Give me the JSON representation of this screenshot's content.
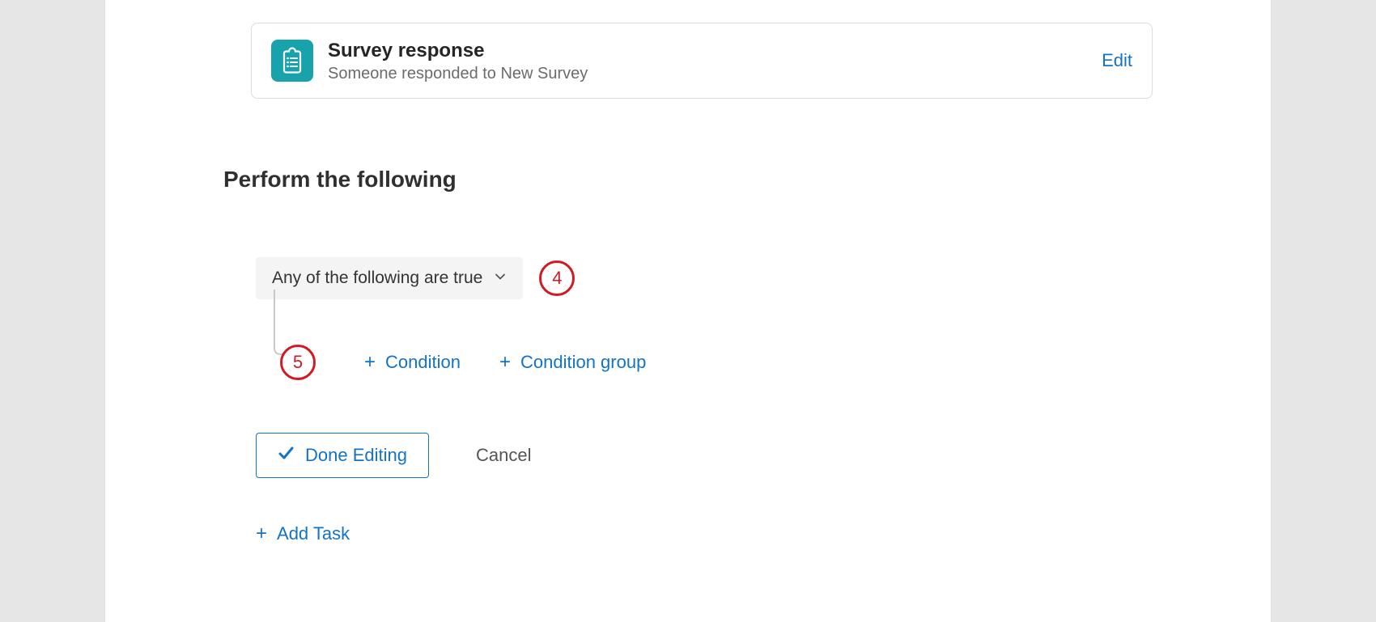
{
  "trigger": {
    "title": "Survey response",
    "description": "Someone responded to New Survey",
    "edit_label": "Edit"
  },
  "section_heading": "Perform the following",
  "condition": {
    "dropdown_label": "Any of the following are true"
  },
  "callouts": {
    "step4": "4",
    "step5": "5"
  },
  "buttons": {
    "add_condition": "Condition",
    "add_condition_group": "Condition group",
    "done_editing": "Done Editing",
    "cancel": "Cancel",
    "add_task": "Add Task"
  }
}
